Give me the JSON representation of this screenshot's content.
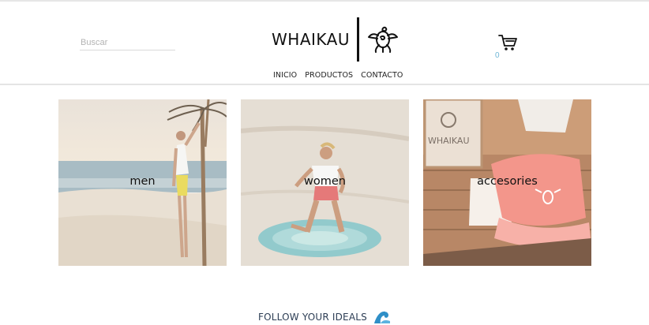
{
  "header": {
    "search": {
      "placeholder": "Buscar",
      "value": ""
    },
    "logo_text": "WHAIKAU",
    "logo_icon": "turtle-logo-icon",
    "nav": [
      "INICIO",
      "PRODUCTOS",
      "CONTACTO"
    ],
    "cart_icon": "shopping-cart-icon",
    "cart_count": "0"
  },
  "categories": [
    {
      "label": "men",
      "image": "man on beach by palm tree"
    },
    {
      "label": "women",
      "image": "woman kneeling on round beach towel"
    },
    {
      "label": "accesories",
      "image": "coral cap with turtle logo"
    }
  ],
  "footer": {
    "tagline": "FOLLOW YOUR IDEALS",
    "icon": "wave-icon"
  },
  "colors": {
    "accent": "#6fb6d6",
    "text": "#222222",
    "divider": "#e4e4e4"
  }
}
